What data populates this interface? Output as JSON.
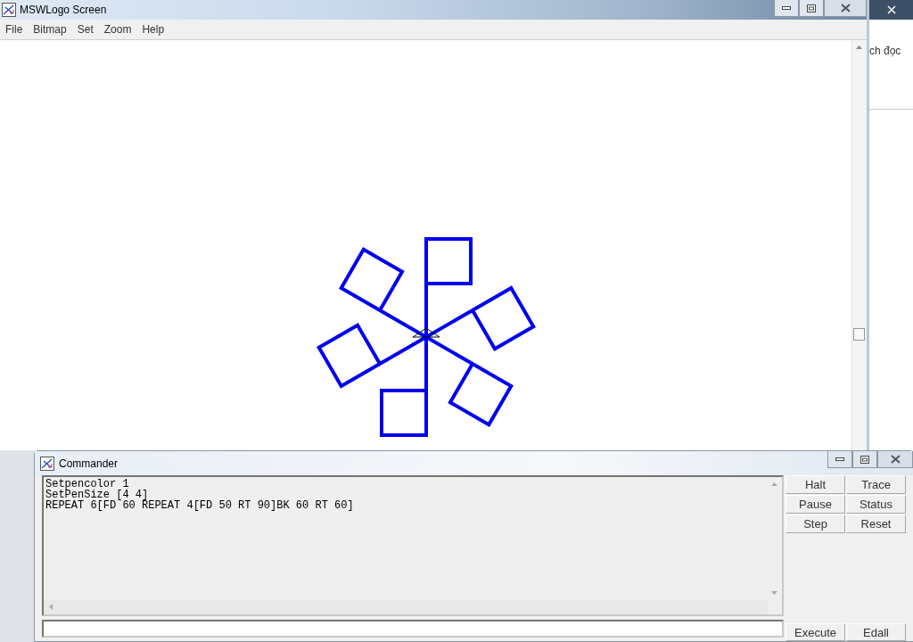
{
  "main_window": {
    "title": "MSWLogo Screen",
    "menu": [
      "File",
      "Bitmap",
      "Set",
      "Zoom",
      "Help"
    ]
  },
  "background_browser": {
    "text": "ch đọc"
  },
  "commander": {
    "title": "Commander",
    "history": [
      "Setpencolor 1",
      "SetPenSize [4 4]",
      "REPEAT 6[FD 60 REPEAT 4[FD 50 RT 90]BK 60 RT 60]"
    ],
    "buttons": [
      "Halt",
      "Trace",
      "Pause",
      "Status",
      "Step",
      "Reset"
    ],
    "bottom_buttons": [
      "Execute",
      "Edall"
    ]
  }
}
